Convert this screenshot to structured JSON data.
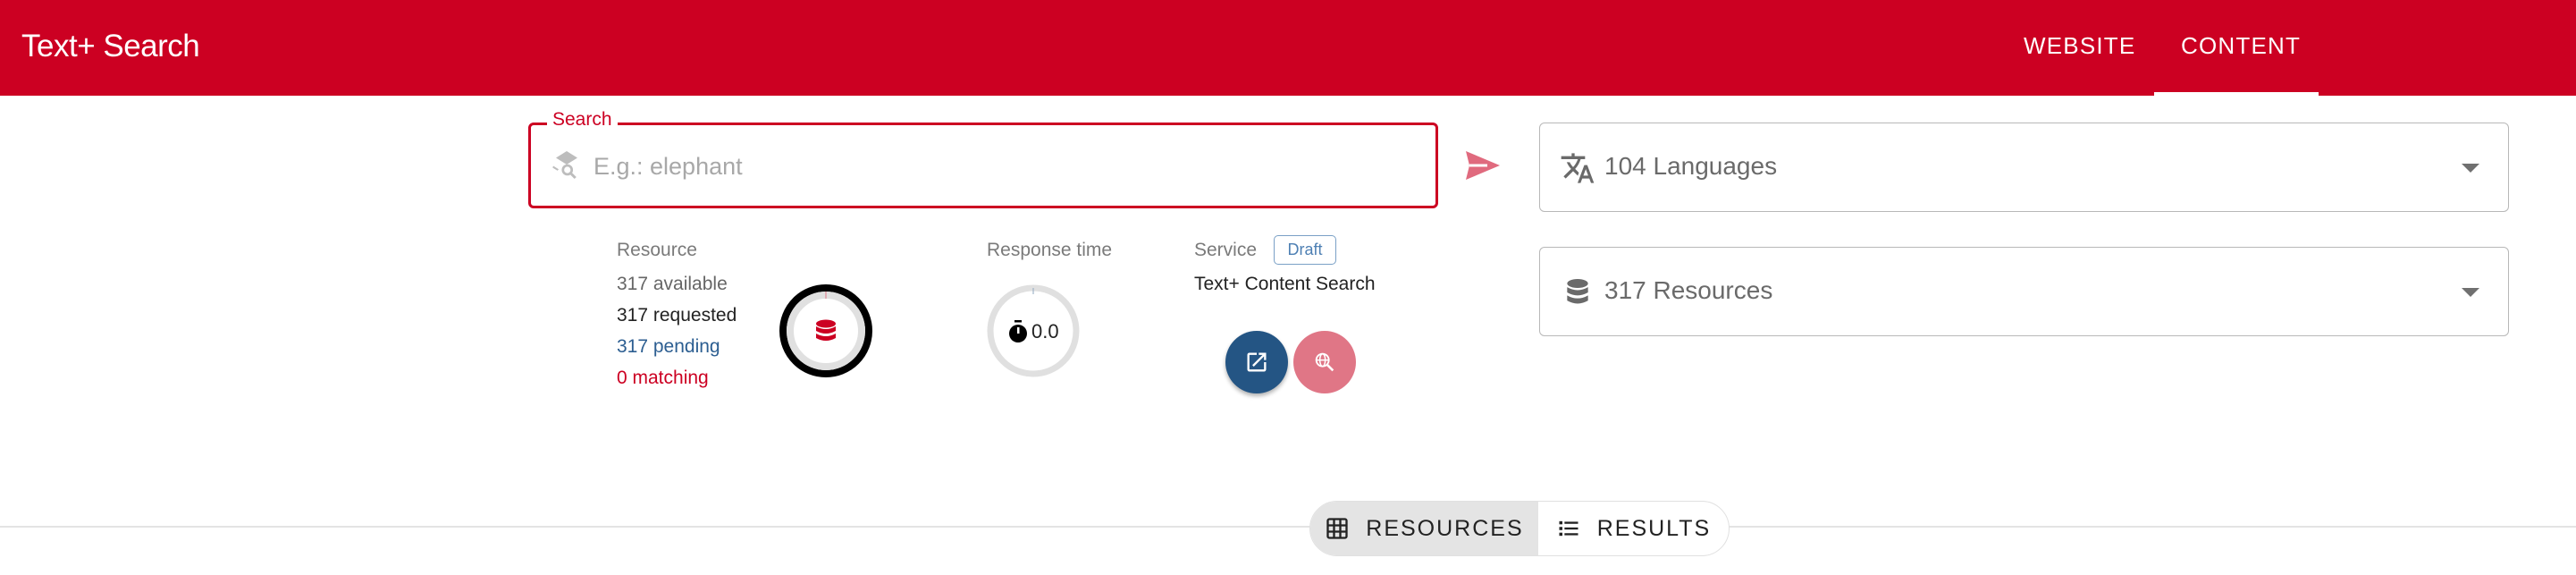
{
  "header": {
    "title": "Text+ Search",
    "nav": [
      {
        "label": "WEBSITE",
        "active": false
      },
      {
        "label": "CONTENT",
        "active": true
      }
    ],
    "brand_color": "#cc0022"
  },
  "search": {
    "label": "Search",
    "value": "",
    "placeholder": "E.g.: elephant",
    "icon": "manage-search-icon",
    "send_icon": "send-icon"
  },
  "resource_stats": {
    "label": "Resource",
    "available": "317 available",
    "requested": "317 requested",
    "pending": "317 pending",
    "matching": "0 matching",
    "gauge_icon": "database-icon",
    "progress_fraction": 0
  },
  "response_time": {
    "label": "Response time",
    "value": "0.0",
    "icon": "timer-icon",
    "progress_fraction": 0
  },
  "service": {
    "label": "Service",
    "badge": "Draft",
    "name": "Text+ Content Search",
    "buttons": [
      {
        "icon": "open-in-new-icon",
        "color": "#245584"
      },
      {
        "icon": "travel-explore-icon",
        "color": "#e07686"
      }
    ]
  },
  "filters": {
    "languages": {
      "label": "104 Languages",
      "icon": "translate-icon"
    },
    "resources": {
      "label": "317 Resources",
      "icon": "database-icon"
    }
  },
  "view_toggle": {
    "options": [
      {
        "label": "RESOURCES",
        "icon": "grid-icon",
        "selected": true
      },
      {
        "label": "RESULTS",
        "icon": "list-icon",
        "selected": false
      }
    ]
  }
}
